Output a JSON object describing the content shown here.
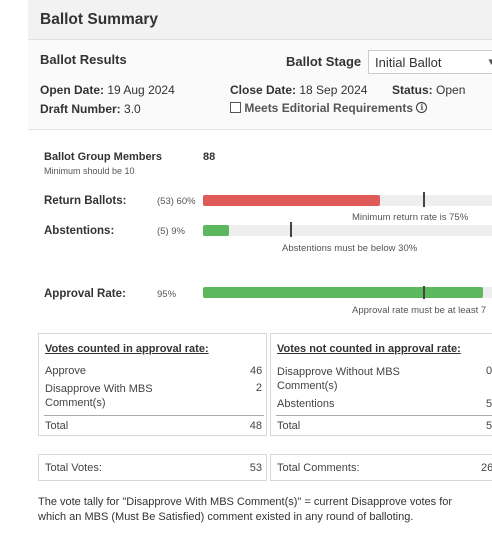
{
  "header": {
    "title": "Ballot Summary"
  },
  "results": {
    "title": "Ballot Results",
    "stage_label": "Ballot Stage",
    "stage_value": "Initial Ballot",
    "open_date_label": "Open Date:",
    "open_date_value": "19 Aug 2024",
    "close_date_label": "Close Date:",
    "close_date_value": "18 Sep 2024",
    "status_label": "Status:",
    "status_value": "Open",
    "draft_label": "Draft Number:",
    "draft_value": "3.0",
    "editorial_label": "Meets Editorial Requirements",
    "editorial_checked": false
  },
  "group": {
    "title": "Ballot Group Members",
    "count": "88",
    "minimum_note": "Minimum should be 10"
  },
  "return_ballots": {
    "label": "Return Ballots:",
    "stat": "(53) 60%",
    "fill_fraction": 0.6,
    "threshold_fraction": 0.75,
    "note": "Minimum return rate is 75%",
    "color": "#e05a5a"
  },
  "abstentions": {
    "label": "Abstentions:",
    "stat": "(5) 9%",
    "fill_fraction": 0.09,
    "threshold_fraction": 0.3,
    "note": "Abstentions must be below 30%",
    "color": "#5cb85c"
  },
  "approval": {
    "label": "Approval Rate:",
    "stat": "95%",
    "fill_fraction": 0.95,
    "threshold_fraction": 0.75,
    "note": "Approval rate must be at least 7",
    "color": "#5cb85c"
  },
  "counted": {
    "title": "Votes counted in approval rate:",
    "rows": [
      {
        "label": "Approve",
        "value": "46"
      },
      {
        "label": "Disapprove With MBS Comment(s)",
        "value": "2"
      }
    ],
    "total_label": "Total",
    "total_value": "48"
  },
  "not_counted": {
    "title": "Votes not counted in approval rate:",
    "rows": [
      {
        "label": "Disapprove Without MBS Comment(s)",
        "value": "0"
      },
      {
        "label": "Abstentions",
        "value": "5"
      }
    ],
    "total_label": "Total",
    "total_value": "5"
  },
  "totals": {
    "votes_label": "Total Votes:",
    "votes_value": "53",
    "comments_label": "Total Comments:",
    "comments_value": "26"
  },
  "footnote": "The vote tally for \"Disapprove With MBS Comment(s)\" = current Disapprove votes for which an MBS (Must Be Satisfied) comment existed in any round of balloting."
}
